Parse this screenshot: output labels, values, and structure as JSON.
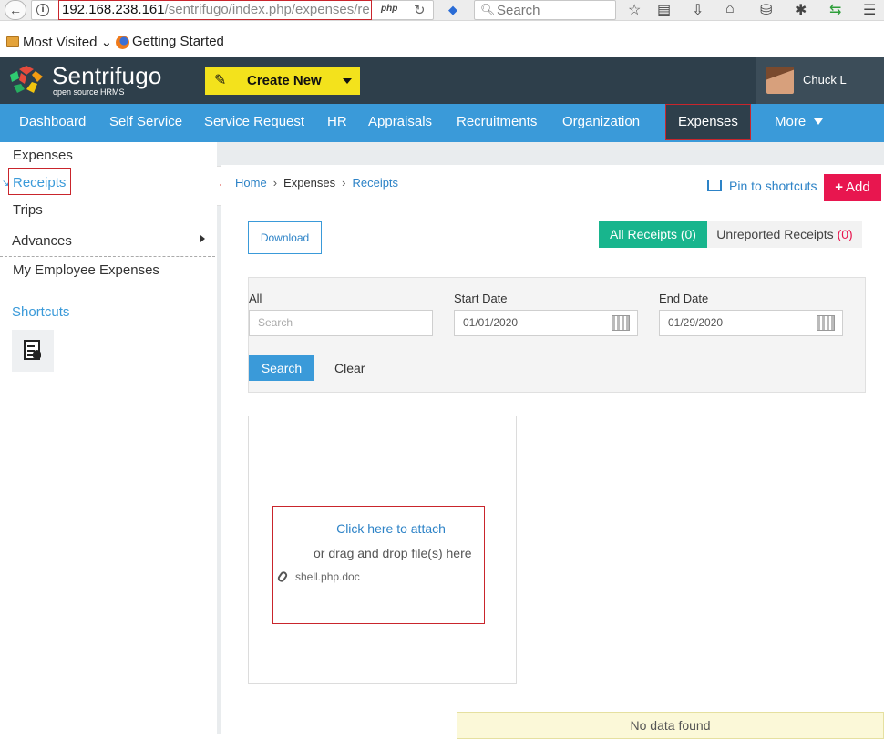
{
  "browser": {
    "url_host": "192.168.238.161",
    "url_path": "/sentrifugo/index.php/expenses/re",
    "php_badge": "php",
    "search_placeholder": "Search",
    "bookmarks": [
      "Most Visited",
      "Getting Started"
    ]
  },
  "header": {
    "brand": "Sentrifugo",
    "brand_sub": "open source HRMS",
    "create_new": "Create New",
    "user_name": "Chuck L"
  },
  "nav": {
    "items": [
      "Dashboard",
      "Self Service",
      "Service Request",
      "HR",
      "Appraisals",
      "Recruitments",
      "Organization",
      "Expenses",
      "More"
    ],
    "active": "Expenses"
  },
  "sidebar": {
    "items": [
      "Expenses",
      "Receipts",
      "Trips",
      "Advances",
      "My Employee Expenses"
    ],
    "active": "Receipts",
    "shortcuts_label": "Shortcuts"
  },
  "breadcrumb": {
    "home": "Home",
    "section": "Expenses",
    "current": "Receipts"
  },
  "actions": {
    "pin": "Pin to shortcuts",
    "add": "Add",
    "download": "Download"
  },
  "tabs": {
    "all_label": "All Receipts (0)",
    "unreported_label": "Unreported Receipts",
    "unreported_count": "(0)"
  },
  "filters": {
    "all_label": "All",
    "search_placeholder": "Search",
    "start_label": "Start Date",
    "start_value": "01/01/2020",
    "end_label": "End Date",
    "end_value": "01/29/2020",
    "search_btn": "Search",
    "clear_btn": "Clear"
  },
  "upload": {
    "attach": "Click here to attach",
    "drag": "or drag and drop file(s) here",
    "file_name": "shell.php.doc"
  },
  "status": {
    "no_data": "No data found"
  },
  "colors": {
    "primary": "#3a9ad9",
    "header": "#2e3f4b",
    "create_new": "#f3e21c",
    "add": "#e8164f",
    "tab_active": "#18b58d",
    "highlight": "#c9252c"
  }
}
